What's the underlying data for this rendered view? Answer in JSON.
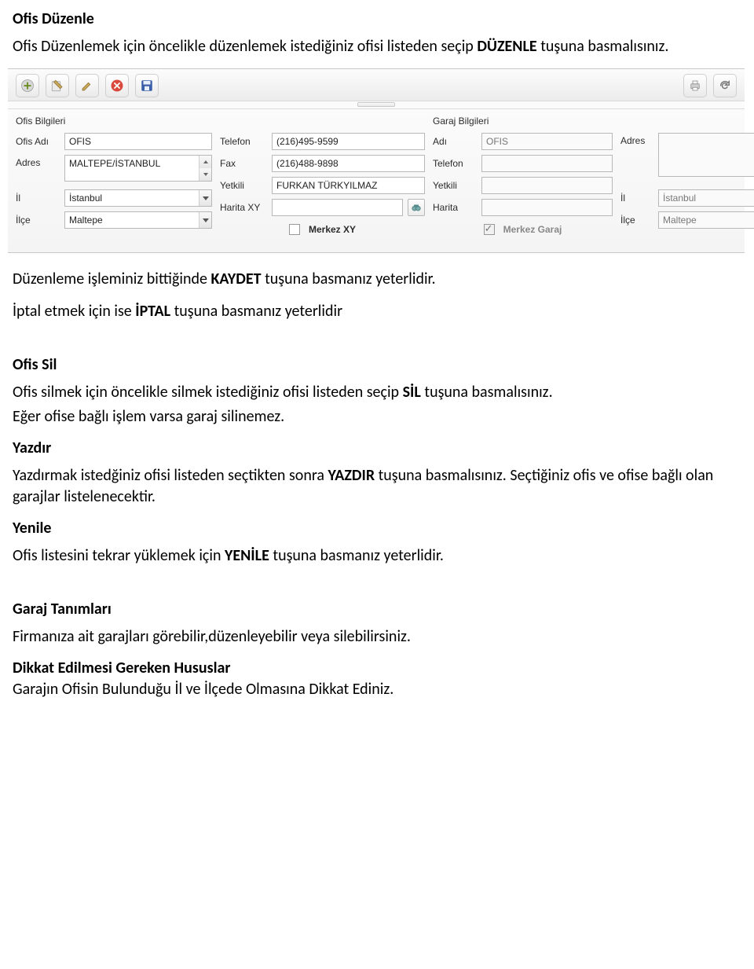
{
  "doc": {
    "h1": "Ofis Düzenle",
    "p1_a": "Ofis Düzenlemek için öncelikle düzenlemek istediğiniz ofisi listeden seçip ",
    "p1_b": "DÜZENLE",
    "p1_c": " tuşuna basmalısınız.",
    "p2_a": "Düzenleme işleminiz bittiğinde ",
    "p2_b": "KAYDET",
    "p2_c": " tuşuna basmanız yeterlidir.",
    "p3_a": "İptal etmek için ise ",
    "p3_b": "İPTAL",
    "p3_c": " tuşuna basmanız yeterlidir",
    "h2": "Ofis Sil",
    "p4_a": "Ofis silmek için öncelikle silmek istediğiniz ofisi listeden seçip ",
    "p4_b": "SİL",
    "p4_c": " tuşuna basmalısınız.",
    "p5": "Eğer ofise bağlı işlem varsa garaj silinemez.",
    "h3": "Yazdır",
    "p6_a": "Yazdırmak istedğiniz ofisi listeden seçtikten sonra ",
    "p6_b": "YAZDIR",
    "p6_c": " tuşuna basmalısınız. Seçtiğiniz ofis ve ofise bağlı olan garajlar listelenecektir.",
    "h4": "Yenile",
    "p7_a": "Ofis listesini tekrar yüklemek için ",
    "p7_b": "YENİLE",
    "p7_c": " tuşuna basmanız yeterlidir.",
    "h5": "Garaj Tanımları",
    "p8": "Firmanıza ait garajları görebilir,düzenleyebilir veya silebilirsiniz.",
    "h6": "Dikkat Edilmesi Gereken Hususlar",
    "p9": "Garajın Ofisin Bulunduğu İl ve İlçede Olmasına Dikkat Ediniz."
  },
  "toolbar": {
    "add": "Ekle",
    "edit": "Düzenle",
    "delete": "Sil",
    "cancel": "İptal",
    "save": "Kaydet",
    "print": "Yazdır",
    "refresh": "Yenile"
  },
  "ofis": {
    "section": "Ofis Bilgileri",
    "labels": {
      "ad": "Ofis Adı",
      "adres": "Adres",
      "il": "İl",
      "ilce": "İlçe",
      "telefon": "Telefon",
      "fax": "Fax",
      "yetkili": "Yetkili",
      "harita": "Harita XY",
      "merkez": "Merkez XY"
    },
    "values": {
      "ad": "OFIS",
      "adres": "MALTEPE/İSTANBUL",
      "il": "İstanbul",
      "ilce": "Maltepe",
      "telefon": "(216)495-9599",
      "fax": "(216)488-9898",
      "yetkili": "FURKAN TÜRKYILMAZ",
      "harita": ""
    }
  },
  "garaj": {
    "section": "Garaj Bilgileri",
    "labels": {
      "ad": "Adı",
      "telefon": "Telefon",
      "yetkili": "Yetkili",
      "harita": "Harita",
      "merkez": "Merkez Garaj",
      "adres": "Adres",
      "il": "İl",
      "ilce": "İlçe"
    },
    "values": {
      "ad": "OFIS",
      "telefon": "",
      "yetkili": "",
      "harita": "",
      "adres": "",
      "il": "İstanbul",
      "ilce": "Maltepe"
    }
  }
}
